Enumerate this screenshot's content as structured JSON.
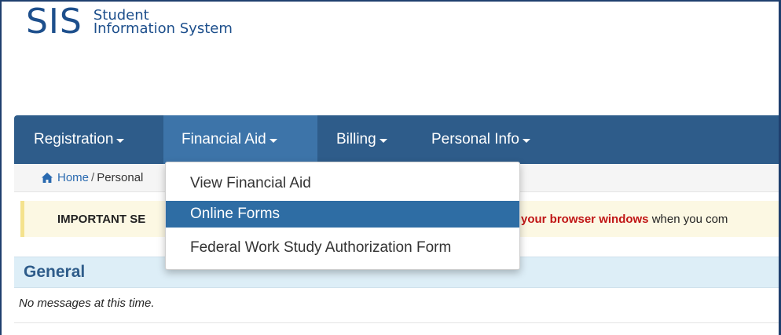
{
  "app": {
    "logo_mark": "SIS",
    "logo_line1": "Student",
    "logo_line2": "Information System"
  },
  "nav": {
    "items": [
      {
        "label": "Registration"
      },
      {
        "label": "Financial Aid",
        "active": true
      },
      {
        "label": "Billing"
      },
      {
        "label": "Personal Info"
      }
    ]
  },
  "breadcrumb": {
    "home": "Home",
    "separator": "/",
    "current": "Personal"
  },
  "alert": {
    "lead": "IMPORTANT SE",
    "highlight": "your browser windows",
    "tail": "when you com"
  },
  "dropdown": {
    "items": [
      {
        "label": "View Financial Aid"
      },
      {
        "label": "Online Forms",
        "selected": true
      },
      {
        "label": "Federal Work Study Authorization Form"
      }
    ]
  },
  "panel": {
    "title": "General",
    "message": "No messages at this time."
  },
  "colors": {
    "brand": "#1d4f8c",
    "navbar": "#2e5c8a",
    "nav_active": "#3d74a9",
    "dropdown_selected": "#2e6da4",
    "alert_bg": "#fcf8e3",
    "alert_highlight": "#c01515",
    "panel_head_bg": "#ddeef7"
  },
  "icons": {
    "breadcrumb_home": "home-icon",
    "nav_caret": "caret-down-icon"
  }
}
